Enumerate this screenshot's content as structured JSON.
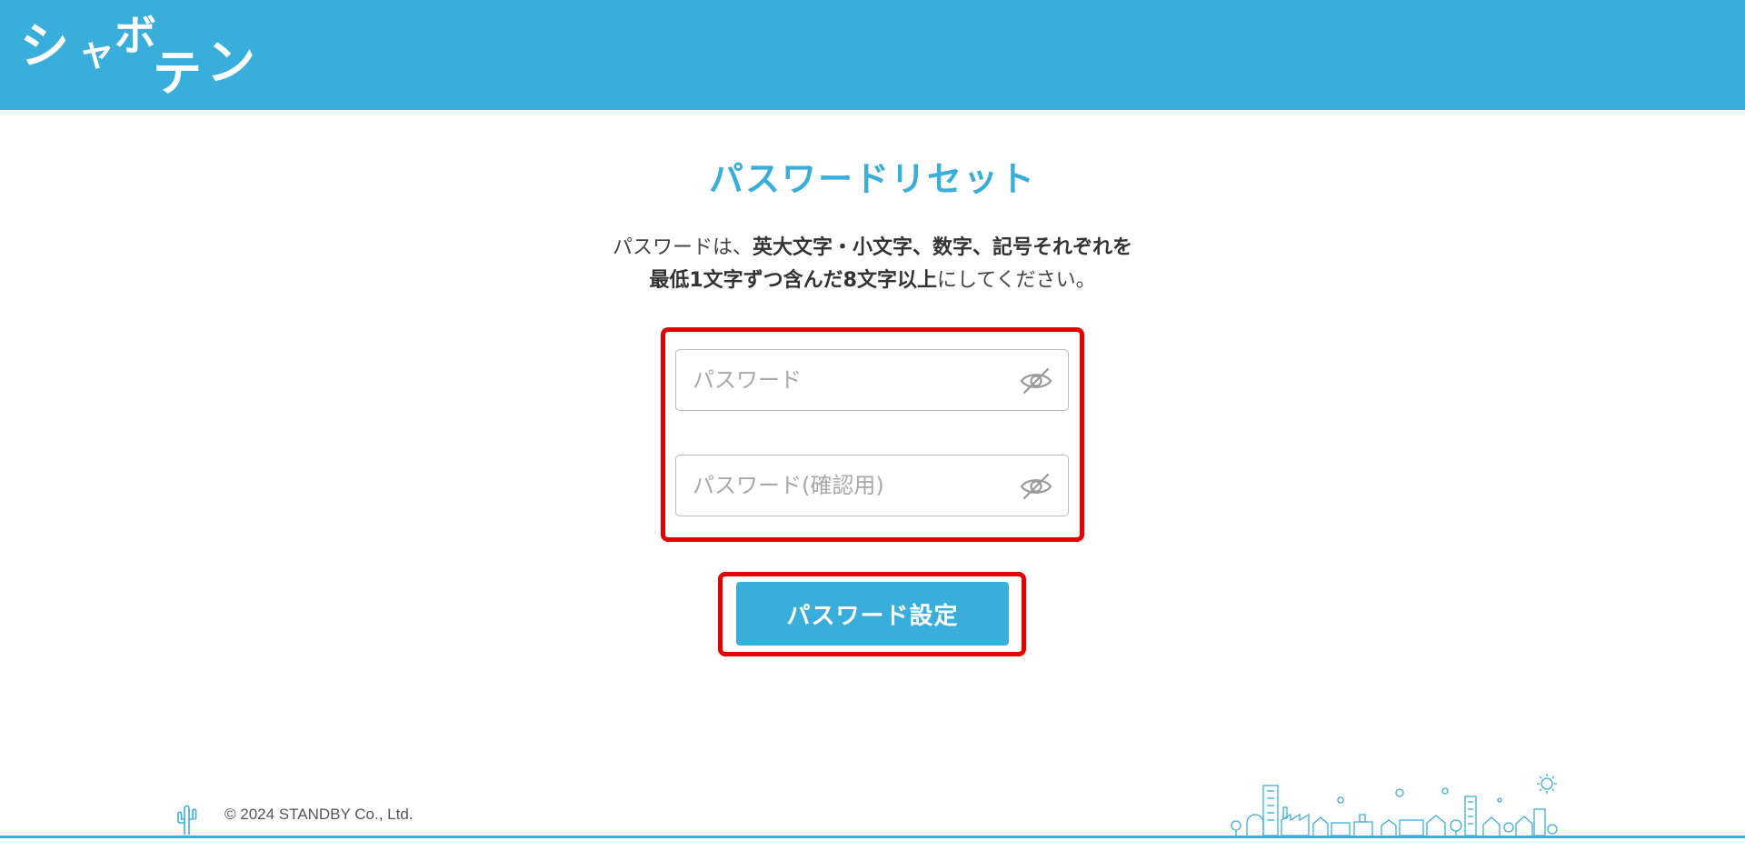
{
  "header": {
    "logo_parts": [
      "シ",
      "ャ",
      "ボ",
      "テ",
      "ン"
    ],
    "logo_text": "シャボテン",
    "background_color": "#3aaedb"
  },
  "main": {
    "title": "パスワードリセット",
    "description": {
      "line1_normal": "パスワードは、",
      "line1_bold": "英大文字・小文字、数字、記号それぞれを",
      "line2_bold": "最低1文字ずつ含んだ8文字以上",
      "line2_normal": "にしてください。"
    },
    "password_field": {
      "placeholder": "パスワード",
      "value": "",
      "toggle_icon": "eye-off-icon"
    },
    "password_confirm_field": {
      "placeholder": "パスワード(確認用)",
      "value": "",
      "toggle_icon": "eye-off-icon"
    },
    "submit_button": {
      "label": "パスワード設定"
    },
    "highlight_color": "#e50000",
    "accent_color": "#3aaedb"
  },
  "footer": {
    "copyright": "© 2024 STANDBY Co., Ltd.",
    "icon_left": "cactus-icon",
    "illustration": "town-illustration"
  }
}
